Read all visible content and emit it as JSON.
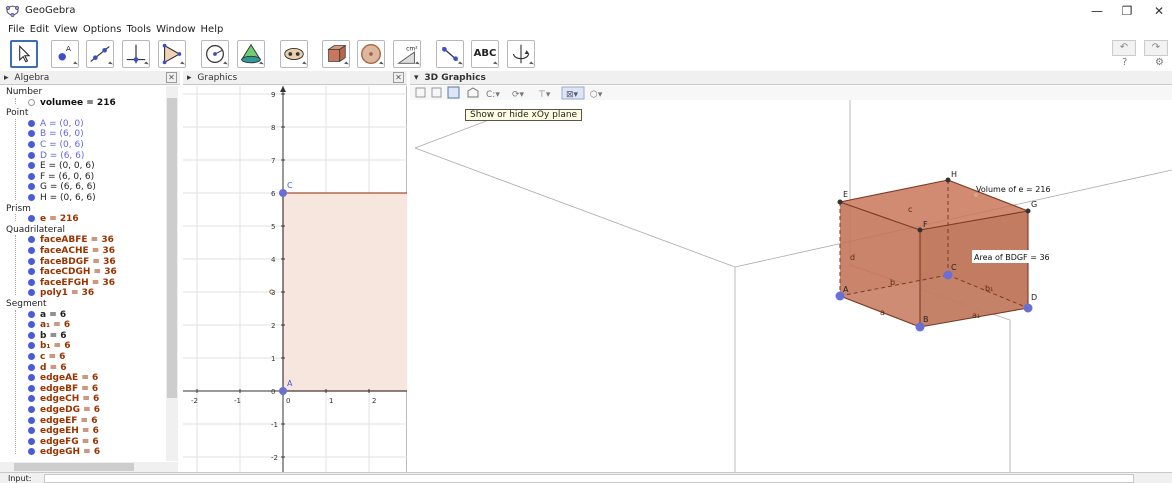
{
  "window": {
    "title": "GeoGebra",
    "minimize": "—",
    "maximize": "❐",
    "close": "✕"
  },
  "menu": [
    "File",
    "Edit",
    "View",
    "Options",
    "Tools",
    "Window",
    "Help"
  ],
  "toolbar": {
    "tools": [
      "move",
      "point",
      "line",
      "perpendicular",
      "polygon",
      "circle",
      "conic",
      "intersect",
      "prism",
      "sphere",
      "area",
      "slope",
      "text",
      "rotate"
    ],
    "text_tool_label": "ABC",
    "area_tool_label": "cm²",
    "undo": "↶",
    "redo": "↷",
    "help": "?",
    "settings": "⚙"
  },
  "panels": {
    "algebra": "Algebra",
    "graphics": "Graphics",
    "graphics3d": "3D Graphics",
    "close": "✕",
    "expand": "▸",
    "collapse": "▾"
  },
  "algebra": {
    "groups": [
      {
        "category": "Number",
        "items": [
          {
            "text": "volumee = 216",
            "color": "#111111",
            "bold": true,
            "shape": "ring"
          }
        ]
      },
      {
        "category": "Point",
        "items": [
          {
            "text": "A = (0, 0)",
            "color": "#6666dd",
            "bold": false,
            "shape": "dot"
          },
          {
            "text": "B = (6, 0)",
            "color": "#6666dd",
            "bold": false,
            "shape": "dot"
          },
          {
            "text": "C = (0, 6)",
            "color": "#6666dd",
            "bold": false,
            "shape": "dot"
          },
          {
            "text": "D = (6, 6)",
            "color": "#6666dd",
            "bold": false,
            "shape": "dot"
          },
          {
            "text": "E = (0, 0, 6)",
            "color": "#222222",
            "bold": false,
            "shape": "dot"
          },
          {
            "text": "F = (6, 0, 6)",
            "color": "#222222",
            "bold": false,
            "shape": "dot"
          },
          {
            "text": "G = (6, 6, 6)",
            "color": "#222222",
            "bold": false,
            "shape": "dot"
          },
          {
            "text": "H = (0, 6, 6)",
            "color": "#222222",
            "bold": false,
            "shape": "dot"
          }
        ]
      },
      {
        "category": "Prism",
        "items": [
          {
            "text": "e = 216",
            "color": "#993300",
            "bold": true,
            "shape": "dot"
          }
        ]
      },
      {
        "category": "Quadrilateral",
        "items": [
          {
            "text": "faceABFE = 36",
            "color": "#993300",
            "bold": true,
            "shape": "dot"
          },
          {
            "text": "faceACHE = 36",
            "color": "#993300",
            "bold": true,
            "shape": "dot"
          },
          {
            "text": "faceBDGF = 36",
            "color": "#993300",
            "bold": true,
            "shape": "dot"
          },
          {
            "text": "faceCDGH = 36",
            "color": "#993300",
            "bold": true,
            "shape": "dot"
          },
          {
            "text": "faceEFGH = 36",
            "color": "#993300",
            "bold": true,
            "shape": "dot"
          },
          {
            "text": "poly1 = 36",
            "color": "#993300",
            "bold": true,
            "shape": "dot"
          }
        ]
      },
      {
        "category": "Segment",
        "items": [
          {
            "text": "a = 6",
            "color": "#222222",
            "bold": true,
            "shape": "dot"
          },
          {
            "text": "a₁ = 6",
            "color": "#993300",
            "bold": true,
            "shape": "dot"
          },
          {
            "text": "b = 6",
            "color": "#222222",
            "bold": true,
            "shape": "dot"
          },
          {
            "text": "b₁ = 6",
            "color": "#993300",
            "bold": true,
            "shape": "dot"
          },
          {
            "text": "c = 6",
            "color": "#993300",
            "bold": true,
            "shape": "dot"
          },
          {
            "text": "d = 6",
            "color": "#993300",
            "bold": true,
            "shape": "dot"
          },
          {
            "text": "edgeAE = 6",
            "color": "#993300",
            "bold": true,
            "shape": "dot"
          },
          {
            "text": "edgeBF = 6",
            "color": "#993300",
            "bold": true,
            "shape": "dot"
          },
          {
            "text": "edgeCH = 6",
            "color": "#993300",
            "bold": true,
            "shape": "dot"
          },
          {
            "text": "edgeDG = 6",
            "color": "#993300",
            "bold": true,
            "shape": "dot"
          },
          {
            "text": "edgeEF = 6",
            "color": "#993300",
            "bold": true,
            "shape": "dot"
          },
          {
            "text": "edgeEH = 6",
            "color": "#993300",
            "bold": true,
            "shape": "dot"
          },
          {
            "text": "edgeFG = 6",
            "color": "#993300",
            "bold": true,
            "shape": "dot"
          },
          {
            "text": "edgeGH = 6",
            "color": "#993300",
            "bold": true,
            "shape": "dot"
          }
        ]
      }
    ],
    "dot_color": "#4a5bd8"
  },
  "graphics2d": {
    "x_ticks": [
      "-2",
      "-1",
      "0",
      "1",
      "2"
    ],
    "y_ticks": [
      "-2",
      "-1",
      "0",
      "1",
      "2",
      "3",
      "4",
      "5",
      "6",
      "7",
      "8",
      "9"
    ],
    "points": {
      "A": "A",
      "C": "C",
      "c_label": "c"
    },
    "fill_color": "#f6e6dd"
  },
  "graphics3d": {
    "tooltip": "Show or hide xOy plane",
    "vertex_labels": [
      "A",
      "B",
      "C",
      "D",
      "E",
      "F",
      "G",
      "H"
    ],
    "edge_labels": [
      "a",
      "a₁",
      "b",
      "b₁",
      "c",
      "d"
    ],
    "volume_label": "Volume of e = 216",
    "area_label": "Area of  BDGF = 36",
    "cube_color": "#c8785a"
  },
  "input": {
    "label": "Input:"
  }
}
